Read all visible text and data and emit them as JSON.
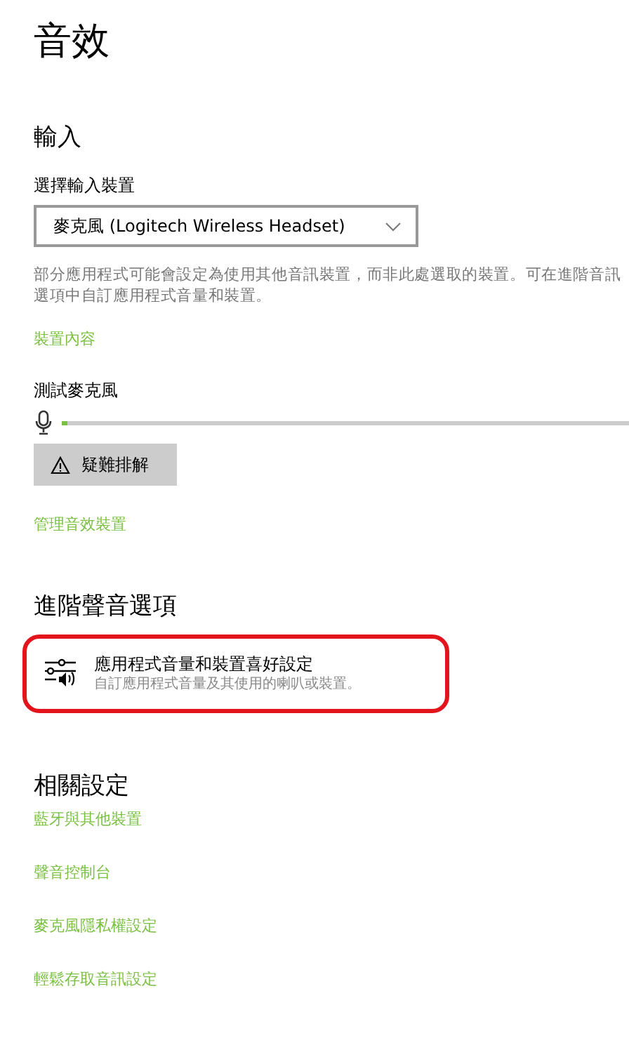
{
  "title": "音效",
  "input": {
    "heading": "輸入",
    "device_label": "選擇輸入裝置",
    "device": "麥克風 (Logitech Wireless Headset)",
    "description": "部分應用程式可能會設定為使用其他音訊裝置，而非此處選取的裝置。可在進階音訊選項中自訂應用程式音量和裝置。",
    "properties_link": "裝置內容",
    "test_label": "測試麥克風",
    "mic_meter": {
      "level": 0.01
    },
    "troubleshoot_button": "疑難排解",
    "manage_link": "管理音效裝置"
  },
  "advanced": {
    "heading": "進階聲音選項",
    "item": {
      "title": "應用程式音量和裝置喜好設定",
      "subtitle": "自訂應用程式音量及其使用的喇叭或裝置。",
      "highlighted": true
    }
  },
  "related": {
    "heading": "相關設定",
    "links": [
      "藍牙與其他裝置",
      "聲音控制台",
      "麥克風隱私權設定",
      "輕鬆存取音訊設定"
    ]
  }
}
